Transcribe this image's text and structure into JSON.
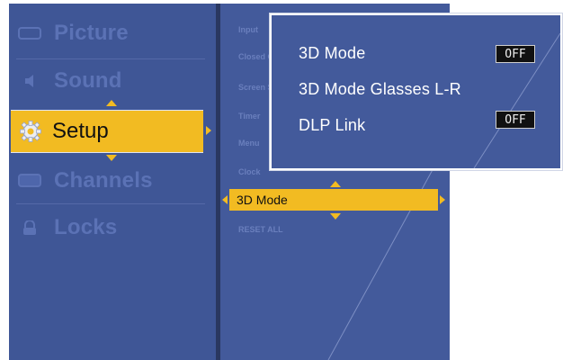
{
  "main_menu": {
    "items": [
      {
        "label": "Picture",
        "icon": "picture-icon"
      },
      {
        "label": "Sound",
        "icon": "speaker-icon"
      },
      {
        "label": "Setup",
        "icon": "gear-icon",
        "selected": true
      },
      {
        "label": "Channels",
        "icon": "tv-icon"
      },
      {
        "label": "Locks",
        "icon": "lock-icon"
      }
    ]
  },
  "setup_menu": {
    "items": [
      {
        "label": "Input"
      },
      {
        "label": "Closed Captions"
      },
      {
        "label": "Screen Saver"
      },
      {
        "label": "Timer"
      },
      {
        "label": "Menu"
      },
      {
        "label": "Clock"
      }
    ],
    "selected_label": "3D Mode",
    "reset_label": "RESET ALL"
  },
  "popup": {
    "rows": [
      {
        "label": "3D Mode",
        "value": "OFF"
      },
      {
        "label": "3D Mode Glasses L-R"
      },
      {
        "label": "DLP Link",
        "value": "OFF"
      }
    ]
  },
  "colors": {
    "panel": "#3f5696",
    "highlight": "#f2bb22",
    "faded_text": "#5b72b5"
  }
}
